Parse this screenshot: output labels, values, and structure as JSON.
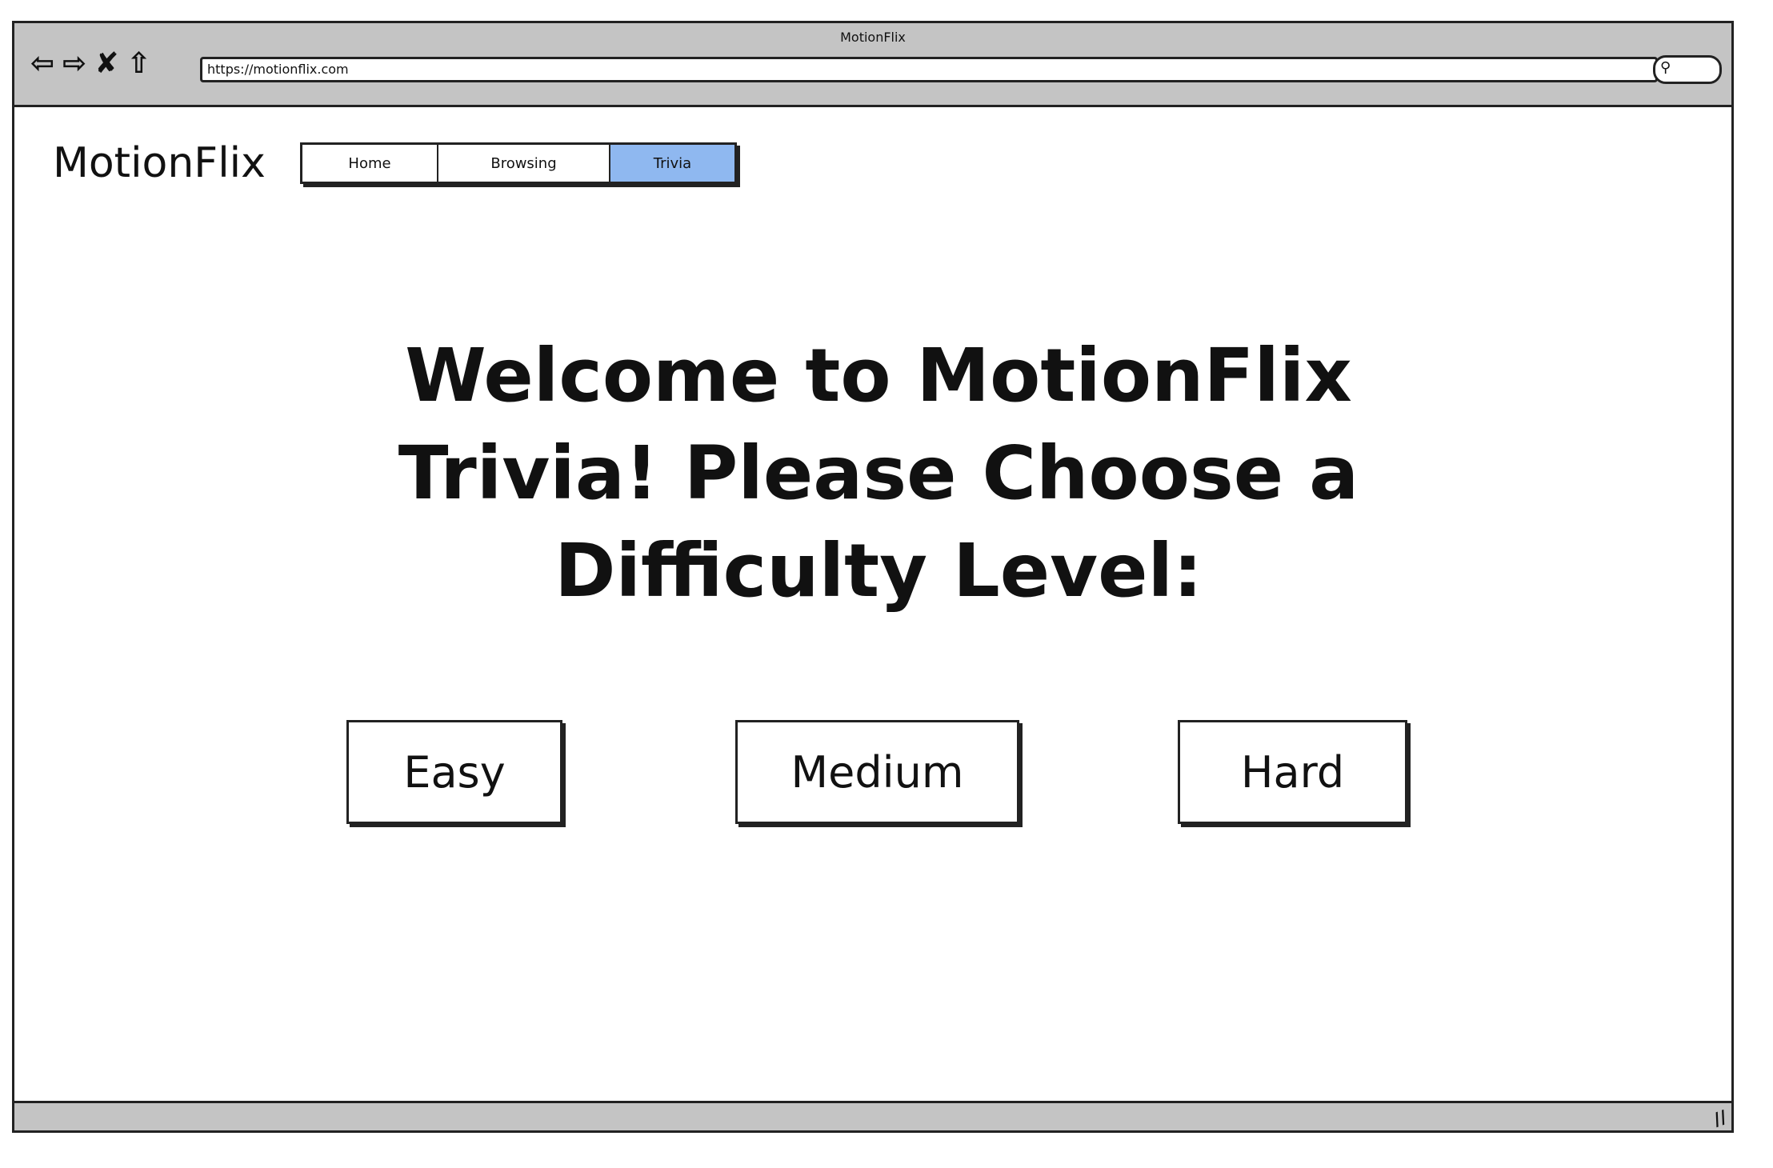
{
  "browser": {
    "title": "MotionFlix",
    "url": "https://motionflix.com"
  },
  "site": {
    "logo": "MotionFlix",
    "tabs": [
      {
        "label": "Home",
        "active": false
      },
      {
        "label": "Browsing",
        "active": false
      },
      {
        "label": "Trivia",
        "active": true
      }
    ],
    "active_tab_color": "#8fb8f0"
  },
  "main": {
    "heading": "Welcome to MotionFlix Trivia! Please Choose a Difficulty Level:",
    "buttons": [
      "Easy",
      "Medium",
      "Hard"
    ]
  }
}
